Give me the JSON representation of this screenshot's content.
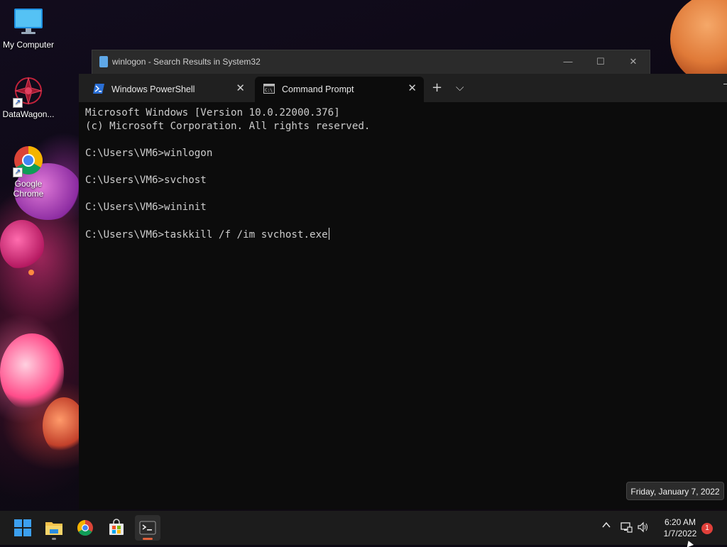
{
  "desktop": {
    "icons": [
      {
        "label": "My Computer",
        "icon": "monitor-icon"
      },
      {
        "label": "DataWagon...",
        "icon": "datawagon-icon"
      },
      {
        "label": "Google\nChrome",
        "icon": "chrome-icon"
      }
    ]
  },
  "back_window": {
    "title": "winlogon - Search Results in System32",
    "minimize": "—",
    "maximize": "☐",
    "close": "✕"
  },
  "terminal": {
    "tabs": [
      {
        "label": "Windows PowerShell",
        "icon": "powershell-icon",
        "active": false
      },
      {
        "label": "Command Prompt",
        "icon": "cmd-icon",
        "active": true
      }
    ],
    "new_tab": "+",
    "dropdown": "⌵",
    "close_tab": "✕",
    "console_lines": [
      "Microsoft Windows [Version 10.0.22000.376]",
      "(c) Microsoft Corporation. All rights reserved.",
      "",
      "C:\\Users\\VM6>winlogon",
      "",
      "C:\\Users\\VM6>svchost",
      "",
      "C:\\Users\\VM6>wininit",
      "",
      "C:\\Users\\VM6>taskkill /f /im svchost.exe"
    ]
  },
  "taskbar": {
    "apps": [
      {
        "name": "start-button",
        "icon": "windows-start-icon"
      },
      {
        "name": "file-explorer",
        "icon": "folder-icon"
      },
      {
        "name": "chrome",
        "icon": "chrome-icon"
      },
      {
        "name": "microsoft-store",
        "icon": "store-icon"
      },
      {
        "name": "terminal",
        "icon": "terminal-icon"
      }
    ],
    "tray": {
      "chevron": "^",
      "time": "6:20 AM",
      "date": "1/7/2022",
      "notifications": "1"
    },
    "tooltip": "Friday, January 7, 2022"
  },
  "colors": {
    "accent_indicator": "#e0603a",
    "badge": "#e0403a",
    "console_bg": "#0c0c0c"
  }
}
